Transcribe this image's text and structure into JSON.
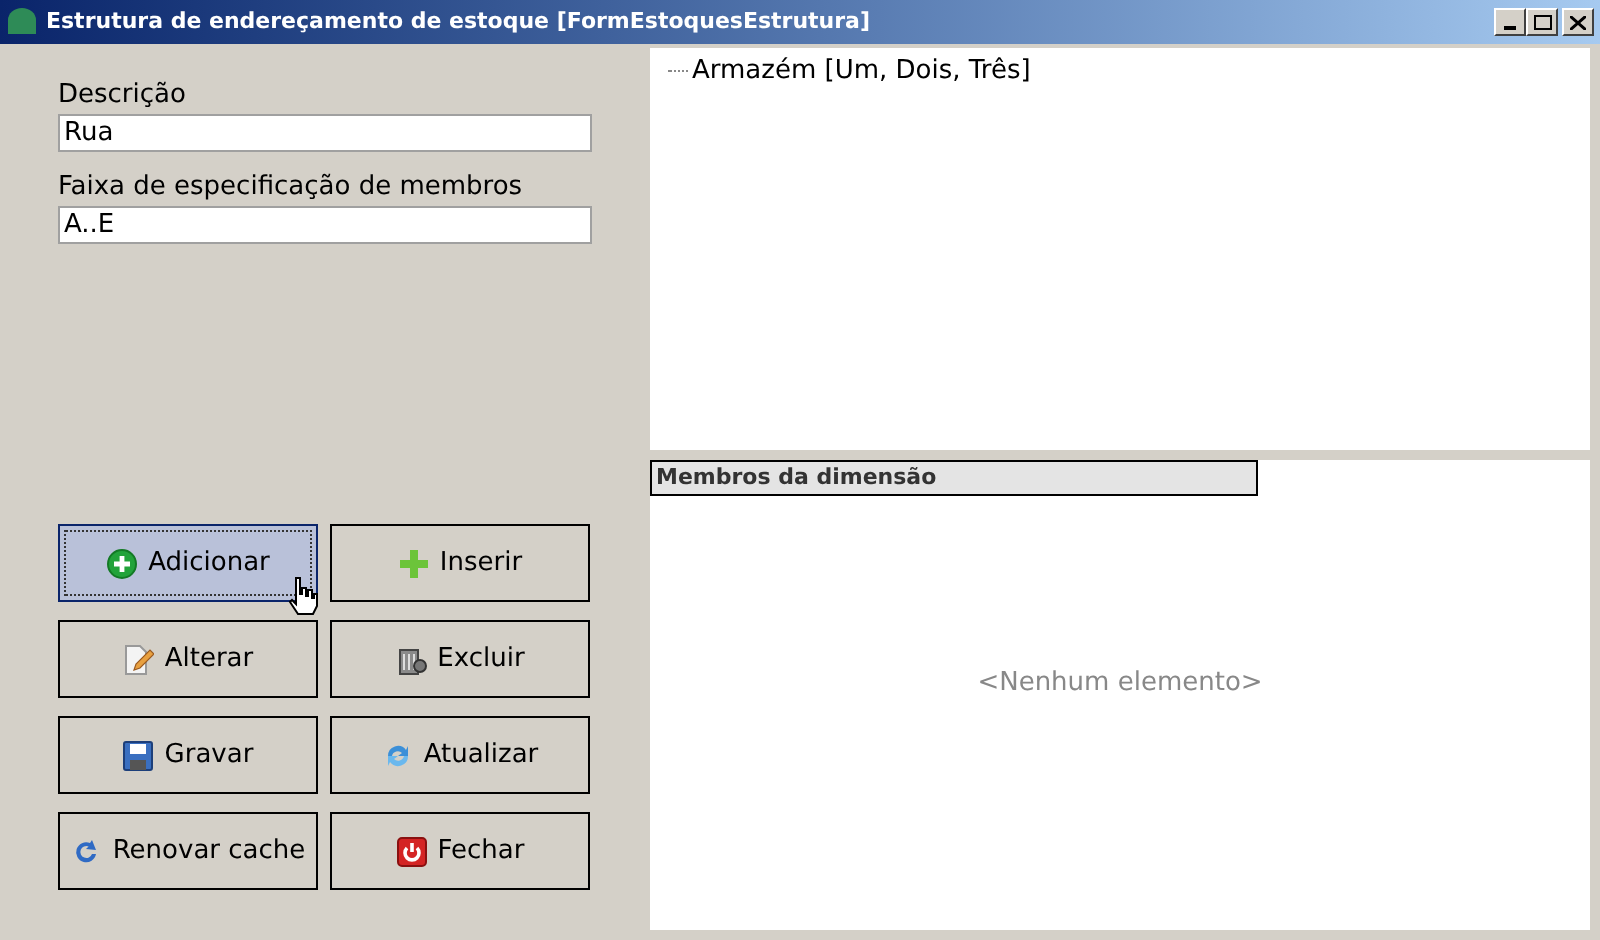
{
  "window": {
    "title": "Estrutura de endereçamento de estoque [FormEstoquesEstrutura]"
  },
  "fields": [
    {
      "label": "Descrição",
      "value": "Rua"
    },
    {
      "label": "Faixa de especificação de membros",
      "value": "A..E"
    }
  ],
  "buttons": [
    {
      "label": "Adicionar",
      "kind": "add",
      "focused": true
    },
    {
      "label": "Inserir",
      "kind": "plus",
      "focused": false
    },
    {
      "label": "Alterar",
      "kind": "edit",
      "focused": false
    },
    {
      "label": "Excluir",
      "kind": "trash",
      "focused": false
    },
    {
      "label": "Gravar",
      "kind": "save",
      "focused": false
    },
    {
      "label": "Atualizar",
      "kind": "sync",
      "focused": false
    },
    {
      "label": "Renovar cache",
      "kind": "refresh",
      "focused": false
    },
    {
      "label": "Fechar",
      "kind": "power",
      "focused": false
    }
  ],
  "tree": {
    "items": [
      {
        "label": "Armazém [Um, Dois, Três]"
      }
    ]
  },
  "members": {
    "header": "Membros da dimensão",
    "empty_text": "<Nenhum elemento>"
  }
}
